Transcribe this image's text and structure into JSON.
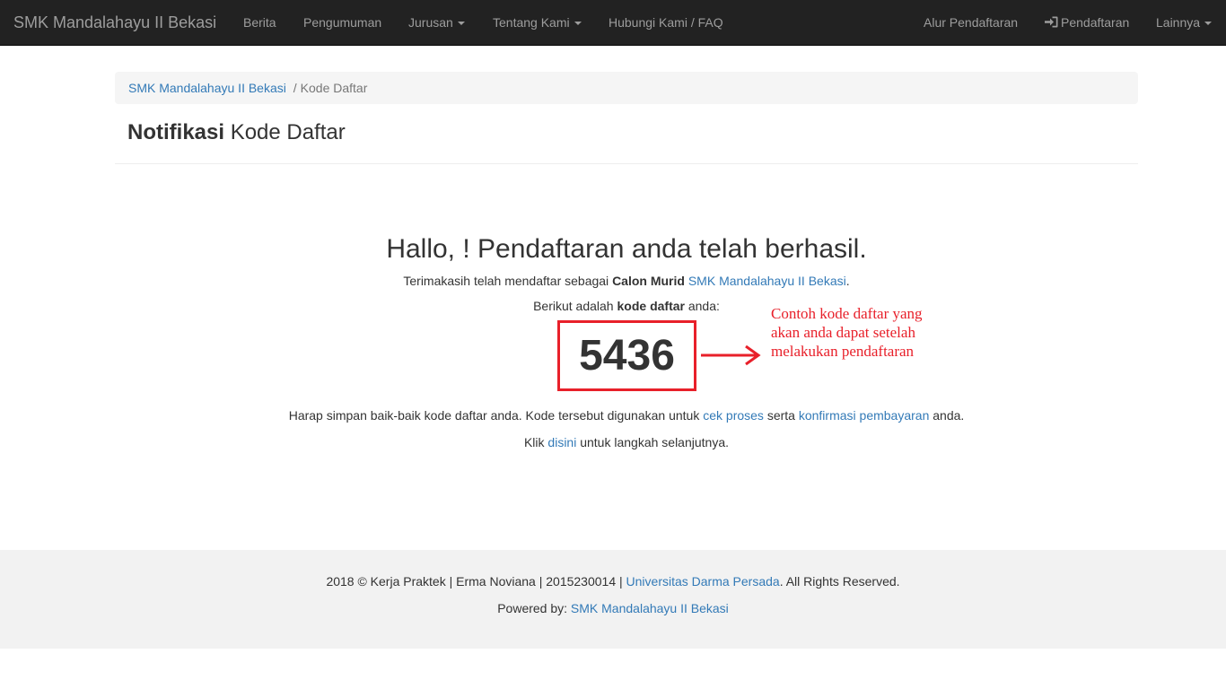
{
  "navbar": {
    "brand": "SMK Mandalahayu II Bekasi",
    "items": [
      {
        "label": "Berita"
      },
      {
        "label": "Pengumuman"
      },
      {
        "label": "Jurusan"
      },
      {
        "label": "Tentang Kami"
      },
      {
        "label": "Hubungi Kami / FAQ"
      },
      {
        "label": "Alur Pendaftaran"
      },
      {
        "label": "Pendaftaran"
      },
      {
        "label": "Lainnya"
      }
    ]
  },
  "breadcrumb": {
    "home": "SMK Mandalahayu II Bekasi",
    "separator": "/",
    "current": "Kode Daftar"
  },
  "page_title": {
    "bold": "Notifikasi",
    "rest": " Kode Daftar"
  },
  "main": {
    "hello": "Hallo, ! Pendaftaran anda telah berhasil.",
    "thanks_prefix": "Terimakasih telah mendaftar sebagai ",
    "thanks_bold": "Calon Murid",
    "thanks_link": "SMK Mandalahayu II Bekasi",
    "thanks_suffix": ".",
    "code_intro_prefix": "Berikut adalah ",
    "code_intro_bold": "kode daftar",
    "code_intro_suffix": " anda:",
    "code": "5436",
    "annotation": "Contoh kode daftar yang akan anda dapat setelah melakukan pendaftaran",
    "save_prefix": "Harap simpan baik-baik kode daftar anda. Kode tersebut digunakan untuk ",
    "save_link1": "cek proses",
    "save_mid": " serta ",
    "save_link2": "konfirmasi pembayaran",
    "save_suffix": " anda.",
    "next_prefix": "Klik ",
    "next_link": "disini",
    "next_suffix": " untuk langkah selanjutnya."
  },
  "footer": {
    "copyright_prefix": "2018 © Kerja Praktek | Erma Noviana | 2015230014 | ",
    "copyright_link": "Universitas Darma Persada",
    "copyright_suffix": ". All Rights Reserved.",
    "powered_prefix": "Powered by: ",
    "powered_link": "SMK Mandalahayu II Bekasi"
  },
  "colors": {
    "navbar_bg": "#222222",
    "link": "#337ab7",
    "annotation_red": "#e8202a",
    "footer_bg": "#f2f2f2"
  }
}
